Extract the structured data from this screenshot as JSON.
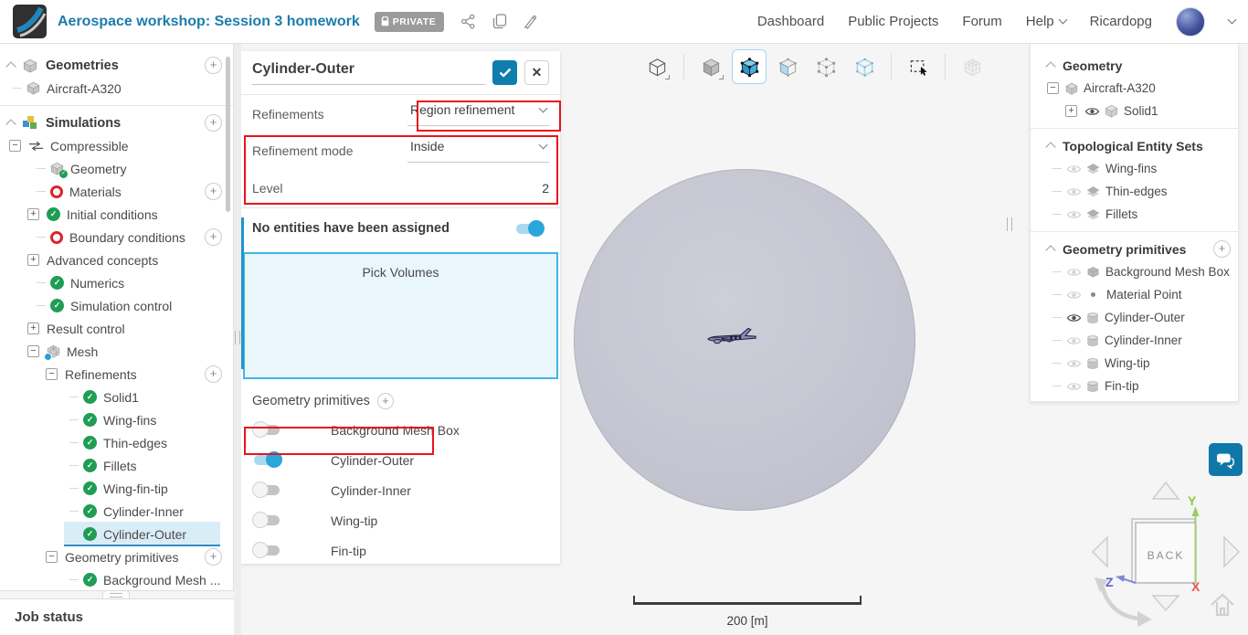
{
  "colors": {
    "brand_blue": "#1b7dab",
    "apply_blue": "#0f7dad",
    "toggle_on_blue": "#29a7dc",
    "annotation_red": "#e8151c",
    "selection_bg": "#d9edf8",
    "pick_area_border": "#41b5e6",
    "axis_x_red": "#e4584d",
    "axis_y_green": "#8dc63f",
    "axis_z_blue": "#5d64cc",
    "sphere_gray": "#c5c6d1"
  },
  "header": {
    "title": "Aerospace workshop: Session 3 homework",
    "privacy_badge": "PRIVATE",
    "nav_items": [
      "Dashboard",
      "Public Projects",
      "Forum",
      "Help"
    ],
    "user_name": "Ricardopg"
  },
  "left_panel": {
    "rows": [
      {
        "label": "Geometries",
        "icon": "cube-icon",
        "header": true,
        "has_add": true
      },
      {
        "label": "Aircraft-A320",
        "icon": "cube-icon"
      },
      {
        "label": "Simulations",
        "icon": "simulation-cubes-icon",
        "header": true,
        "has_add": true
      },
      {
        "label": "Compressible",
        "icon": "flow-arrows-icon",
        "expander": "minus"
      },
      {
        "label": "Geometry",
        "icon": "cube-check-icon"
      },
      {
        "label": "Materials",
        "icon": "incomplete-ring-icon",
        "has_add": true
      },
      {
        "label": "Initial conditions",
        "icon": "check-icon",
        "expander": "plus"
      },
      {
        "label": "Boundary conditions",
        "icon": "incomplete-ring-icon",
        "has_add": true
      },
      {
        "label": "Advanced concepts",
        "expander": "plus"
      },
      {
        "label": "Numerics",
        "icon": "check-icon"
      },
      {
        "label": "Simulation control",
        "icon": "check-icon"
      },
      {
        "label": "Result control",
        "expander": "plus"
      },
      {
        "label": "Mesh",
        "icon": "mesh-cube-icon",
        "expander": "minus"
      },
      {
        "label": "Refinements",
        "expander": "minus",
        "has_add": true
      },
      {
        "label": "Solid1",
        "icon": "check-icon"
      },
      {
        "label": "Wing-fins",
        "icon": "check-icon"
      },
      {
        "label": "Thin-edges",
        "icon": "check-icon"
      },
      {
        "label": "Fillets",
        "icon": "check-icon"
      },
      {
        "label": "Wing-fin-tip",
        "icon": "check-icon"
      },
      {
        "label": "Cylinder-Inner",
        "icon": "check-icon"
      },
      {
        "label": "Cylinder-Outer",
        "icon": "check-icon",
        "selected": true
      },
      {
        "label": "Geometry primitives",
        "expander": "minus",
        "has_add": true
      },
      {
        "label": "Background Mesh ...",
        "icon": "check-icon"
      }
    ],
    "job_status": "Job status"
  },
  "properties_panel": {
    "title": "Cylinder-Outer",
    "rows": [
      {
        "label": "Refinements",
        "value": "Region refinement",
        "type": "select"
      },
      {
        "label": "Refinement mode",
        "value": "Inside",
        "type": "select"
      },
      {
        "label": "Level",
        "value": "2",
        "type": "number"
      }
    ],
    "assignment_message": "No entities have been assigned",
    "assignment_toggle_on": true,
    "pick_button": "Pick Volumes",
    "primitives_header": "Geometry primitives",
    "primitive_toggles": [
      {
        "label": "Background Mesh Box",
        "on": false
      },
      {
        "label": "Cylinder-Outer",
        "on": true,
        "annotated": true
      },
      {
        "label": "Cylinder-Inner",
        "on": false
      },
      {
        "label": "Wing-tip",
        "on": false
      },
      {
        "label": "Fin-tip",
        "on": false
      }
    ],
    "annotations": [
      "refinements-type-select",
      "refinement-mode-and-level",
      "cylinder-outer-visibility-toggle"
    ]
  },
  "viewport": {
    "toolbar_icons": [
      "wireframe-view",
      "solid-view",
      "solid-selected-view",
      "face-select",
      "vertex-select",
      "edge-select",
      "box-select",
      "mesh-view"
    ],
    "active_tool": "solid-selected-view",
    "scale_bar_label": "200 [m]",
    "nav_cube": {
      "face_label": "BACK",
      "axis_x": "X",
      "axis_y": "Y",
      "axis_z": "Z"
    }
  },
  "right_panel": {
    "sections": [
      {
        "title": "Geometry",
        "items": [
          {
            "label": "Aircraft-A320",
            "icon": "cube-icon",
            "expander": "minus"
          },
          {
            "label": "Solid1",
            "icon": "cube-icon",
            "expander": "plus",
            "visible": true
          }
        ]
      },
      {
        "title": "Topological Entity Sets",
        "items": [
          {
            "label": "Wing-fins",
            "icon": "faces-icon",
            "visible": false
          },
          {
            "label": "Thin-edges",
            "icon": "faces-icon",
            "visible": false
          },
          {
            "label": "Fillets",
            "icon": "faces-icon",
            "visible": false
          }
        ]
      },
      {
        "title": "Geometry primitives",
        "has_add": true,
        "items": [
          {
            "label": "Background Mesh Box",
            "icon": "box-icon",
            "visible": false
          },
          {
            "label": "Material Point",
            "icon": "point-icon",
            "visible": false
          },
          {
            "label": "Cylinder-Outer",
            "icon": "cylinder-icon",
            "visible": true
          },
          {
            "label": "Cylinder-Inner",
            "icon": "cylinder-icon",
            "visible": false
          },
          {
            "label": "Wing-tip",
            "icon": "cylinder-icon",
            "visible": false
          },
          {
            "label": "Fin-tip",
            "icon": "cylinder-icon",
            "visible": false
          }
        ]
      }
    ]
  }
}
